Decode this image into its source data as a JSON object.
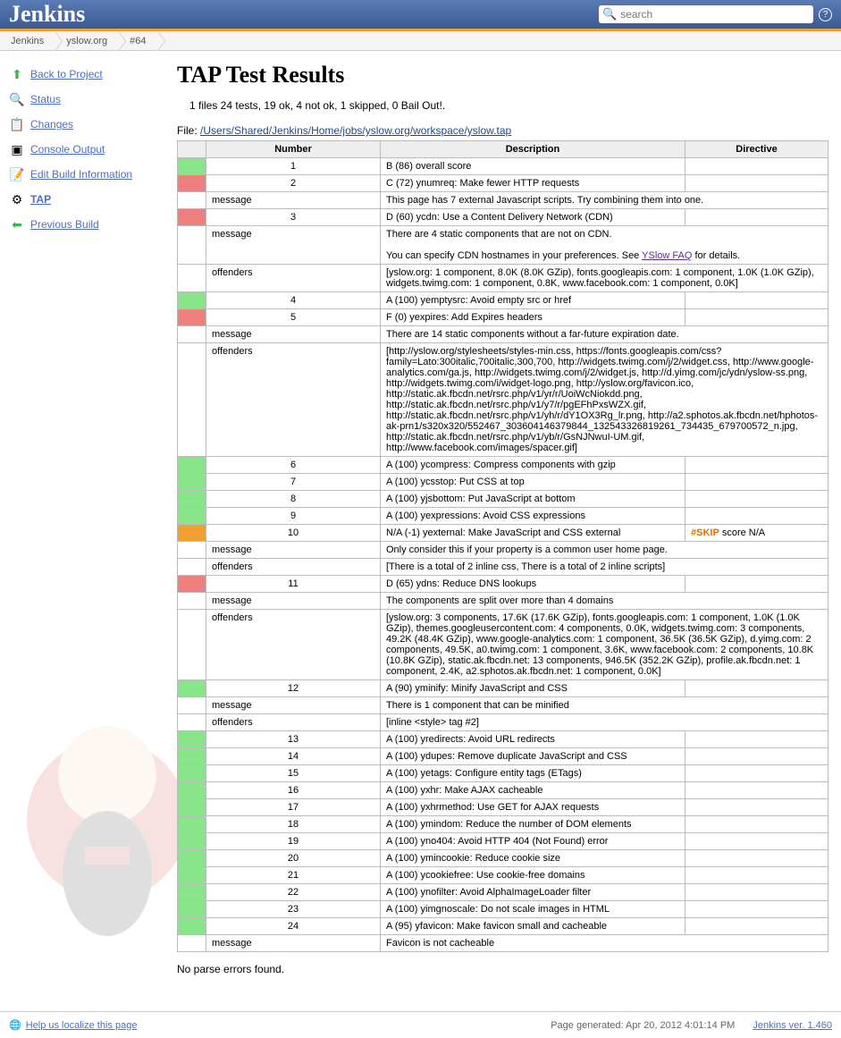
{
  "header": {
    "logo": "Jenkins",
    "search_placeholder": "search"
  },
  "breadcrumbs": [
    "Jenkins",
    "yslow.org",
    "#64"
  ],
  "sidebar": [
    {
      "label": "Back to Project",
      "icon": "⬆",
      "color": "#39b54a"
    },
    {
      "label": "Status",
      "icon": "🔍"
    },
    {
      "label": "Changes",
      "icon": "📋"
    },
    {
      "label": "Console Output",
      "icon": "▣"
    },
    {
      "label": "Edit Build Information",
      "icon": "📝"
    },
    {
      "label": "TAP",
      "icon": "⚙",
      "bold": true
    },
    {
      "label": "Previous Build",
      "icon": "⬅",
      "color": "#39b54a"
    }
  ],
  "title": "TAP Test Results",
  "summary": "1 files 24 tests, 19 ok, 4 not ok, 1 skipped, 0 Bail Out!.",
  "file_label": "File: ",
  "file_path": "/Users/Shared/Jenkins/Home/jobs/yslow.org/workspace/yslow.tap",
  "headers": {
    "number": "Number",
    "description": "Description",
    "directive": "Directive"
  },
  "rows": [
    {
      "type": "test",
      "status": "ok",
      "num": "1",
      "desc": "B (86) overall score"
    },
    {
      "type": "test",
      "status": "notok",
      "num": "2",
      "desc": "C (72) ynumreq: Make fewer HTTP requests"
    },
    {
      "type": "sub",
      "key": "message",
      "val": "This page has 7 external Javascript scripts. Try combining them into one."
    },
    {
      "type": "test",
      "status": "notok",
      "num": "3",
      "desc": "D (60) ycdn: Use a Content Delivery Network (CDN)"
    },
    {
      "type": "subblock",
      "key": "message",
      "val": "There are 4 static components that are not on CDN.\n\nYou can specify CDN hostnames in your preferences. See ",
      "link": "YSlow FAQ",
      "after": " for details."
    },
    {
      "type": "sub",
      "key": "offenders",
      "val": "[yslow.org: 1 component, 8.0K (8.0K GZip), fonts.googleapis.com: 1 component, 1.0K (1.0K GZip), widgets.twimg.com: 1 component, 0.8K, www.facebook.com: 1 component, 0.0K]"
    },
    {
      "type": "test",
      "status": "ok",
      "num": "4",
      "desc": "A (100) yemptysrc: Avoid empty src or href"
    },
    {
      "type": "test",
      "status": "notok",
      "num": "5",
      "desc": "F (0) yexpires: Add Expires headers"
    },
    {
      "type": "sub",
      "key": "message",
      "val": "There are 14 static components without a far-future expiration date."
    },
    {
      "type": "sub",
      "key": "offenders",
      "val": "[http://yslow.org/stylesheets/styles-min.css, https://fonts.googleapis.com/css?family=Lato:300italic,700italic,300,700, http://widgets.twimg.com/j/2/widget.css, http://www.google-analytics.com/ga.js, http://widgets.twimg.com/j/2/widget.js, http://d.yimg.com/jc/ydn/yslow-ss.png, http://widgets.twimg.com/i/widget-logo.png, http://yslow.org/favicon.ico, http://static.ak.fbcdn.net/rsrc.php/v1/yr/r/UoiWcNiokdd.png, http://static.ak.fbcdn.net/rsrc.php/v1/y7/r/pgEFhPxsWZX.gif, http://static.ak.fbcdn.net/rsrc.php/v1/yh/r/dY1OX3Rg_lr.png, http://a2.sphotos.ak.fbcdn.net/hphotos-ak-prn1/s320x320/552467_303604146379844_132543326819261_734435_679700572_n.jpg, http://static.ak.fbcdn.net/rsrc.php/v1/yb/r/GsNJNwuI-UM.gif, http://www.facebook.com/images/spacer.gif]"
    },
    {
      "type": "test",
      "status": "ok",
      "num": "6",
      "desc": "A (100) ycompress: Compress components with gzip"
    },
    {
      "type": "test",
      "status": "ok",
      "num": "7",
      "desc": "A (100) ycsstop: Put CSS at top"
    },
    {
      "type": "test",
      "status": "ok",
      "num": "8",
      "desc": "A (100) yjsbottom: Put JavaScript at bottom"
    },
    {
      "type": "test",
      "status": "ok",
      "num": "9",
      "desc": "A (100) yexpressions: Avoid CSS expressions"
    },
    {
      "type": "test",
      "status": "skip",
      "num": "10",
      "desc": "N/A (-1) yexternal: Make JavaScript and CSS external",
      "dir": "#SKIP",
      "dir_after": " score N/A"
    },
    {
      "type": "sub2",
      "key": "message",
      "val": "Only consider this if your property is a common user home page."
    },
    {
      "type": "sub2",
      "key": "offenders",
      "val": "[There is a total of 2 inline css, There is a total of 2 inline scripts]"
    },
    {
      "type": "test",
      "status": "notok",
      "num": "11",
      "desc": "D (65) ydns: Reduce DNS lookups"
    },
    {
      "type": "sub",
      "key": "message",
      "val": "The components are split over more than 4 domains"
    },
    {
      "type": "sub",
      "key": "offenders",
      "val": "[yslow.org: 3 components, 17.6K (17.6K GZip), fonts.googleapis.com: 1 component, 1.0K (1.0K GZip), themes.googleusercontent.com: 4 components, 0.0K, widgets.twimg.com: 3 components, 49.2K (48.4K GZip), www.google-analytics.com: 1 component, 36.5K (36.5K GZip), d.yimg.com: 2 components, 49.5K, a0.twimg.com: 1 component, 3.6K, www.facebook.com: 2 components, 10.8K (10.8K GZip), static.ak.fbcdn.net: 13 components, 946.5K (352.2K GZip), profile.ak.fbcdn.net: 1 component, 2.4K, a2.sphotos.ak.fbcdn.net: 1 component, 0.0K]"
    },
    {
      "type": "test",
      "status": "ok",
      "num": "12",
      "desc": "A (90) yminify: Minify JavaScript and CSS"
    },
    {
      "type": "sub3",
      "key": "message",
      "val": "There is 1 component that can be minified"
    },
    {
      "type": "sub3",
      "key": "offenders",
      "val": "[inline <style> tag #2]"
    },
    {
      "type": "test",
      "status": "ok",
      "num": "13",
      "desc": "A (100) yredirects: Avoid URL redirects"
    },
    {
      "type": "test",
      "status": "ok",
      "num": "14",
      "desc": "A (100) ydupes: Remove duplicate JavaScript and CSS"
    },
    {
      "type": "test",
      "status": "ok",
      "num": "15",
      "desc": "A (100) yetags: Configure entity tags (ETags)"
    },
    {
      "type": "test",
      "status": "ok",
      "num": "16",
      "desc": "A (100) yxhr: Make AJAX cacheable"
    },
    {
      "type": "test",
      "status": "ok",
      "num": "17",
      "desc": "A (100) yxhrmethod: Use GET for AJAX requests"
    },
    {
      "type": "test",
      "status": "ok",
      "num": "18",
      "desc": "A (100) ymindom: Reduce the number of DOM elements"
    },
    {
      "type": "test",
      "status": "ok",
      "num": "19",
      "desc": "A (100) yno404: Avoid HTTP 404 (Not Found) error"
    },
    {
      "type": "test",
      "status": "ok",
      "num": "20",
      "desc": "A (100) ymincookie: Reduce cookie size"
    },
    {
      "type": "test",
      "status": "ok",
      "num": "21",
      "desc": "A (100) ycookiefree: Use cookie-free domains"
    },
    {
      "type": "test",
      "status": "ok",
      "num": "22",
      "desc": "A (100) ynofilter: Avoid AlphaImageLoader filter"
    },
    {
      "type": "test",
      "status": "ok",
      "num": "23",
      "desc": "A (100) yimgnoscale: Do not scale images in HTML"
    },
    {
      "type": "test",
      "status": "ok",
      "num": "24",
      "desc": "A (95) yfavicon: Make favicon small and cacheable"
    },
    {
      "type": "sub4",
      "key": "message",
      "val": "Favicon is not cacheable"
    }
  ],
  "no_parse": "No parse errors found.",
  "footer": {
    "localize": "Help us localize this page",
    "generated": "Page generated: Apr 20, 2012 4:01:14 PM",
    "version": "Jenkins ver. 1.460"
  }
}
